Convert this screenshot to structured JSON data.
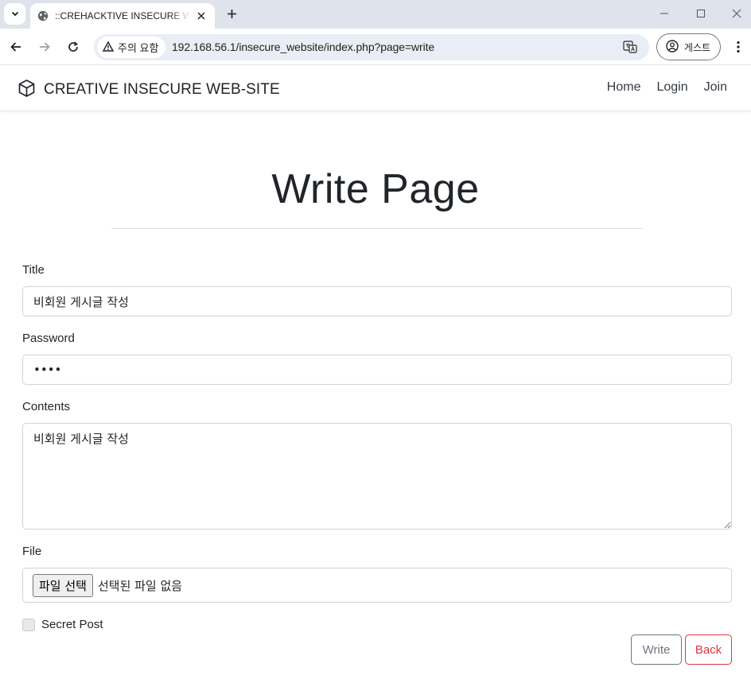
{
  "browser": {
    "tab_title": "::CREHACKTIVE INSECURE WEB-SITE",
    "security_label": "주의 요함",
    "url": "192.168.56.1/insecure_website/index.php?page=write",
    "profile_label": "게스트"
  },
  "navbar": {
    "brand": "CREATIVE INSECURE WEB-SITE",
    "links": [
      "Home",
      "Login",
      "Join"
    ]
  },
  "page": {
    "title": "Write Page"
  },
  "form": {
    "title_label": "Title",
    "title_value": "비회원 게시글 작성",
    "password_label": "Password",
    "password_value": "1234",
    "contents_label": "Contents",
    "contents_value": "비회원 게시글 작성",
    "file_label": "File",
    "file_button": "파일 선택",
    "file_status": "선택된 파일 없음",
    "secret_label": "Secret Post",
    "secret_checked": false,
    "write_button": "Write",
    "back_button": "Back"
  },
  "colors": {
    "accent_secondary": "#6c757d",
    "accent_danger": "#dc3545"
  }
}
